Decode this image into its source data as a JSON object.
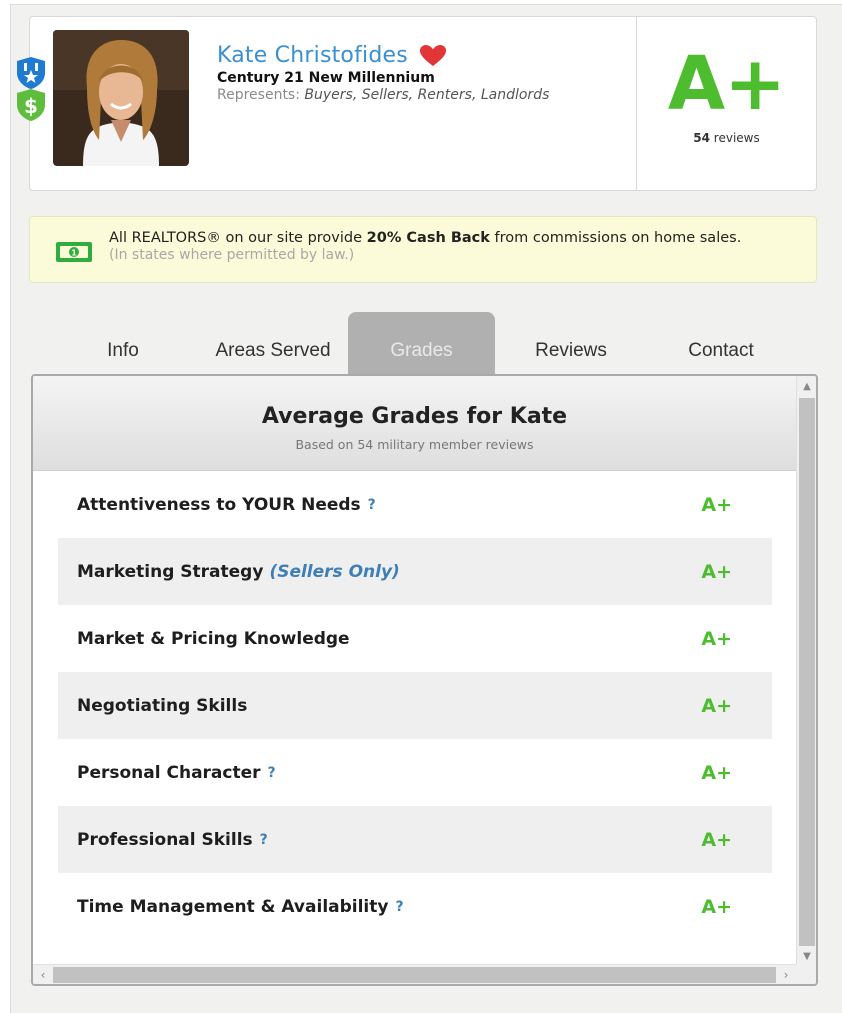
{
  "agent": {
    "name": "Kate Christofides",
    "brokerage": "Century 21 New Millennium",
    "represents_label": "Represents:",
    "represents_values": "Buyers, Sellers, Renters, Landlords",
    "overall_grade": "A+",
    "review_count": "54",
    "review_suffix": "reviews"
  },
  "banner": {
    "text_pre": "All REALTORS® on our site provide ",
    "text_bold": "20% Cash Back",
    "text_post": " from commissions on home sales.",
    "note": "(In states where permitted by law.)"
  },
  "tabs": [
    {
      "label": "Info",
      "active": false
    },
    {
      "label": "Areas Served",
      "active": false
    },
    {
      "label": "Grades",
      "active": true
    },
    {
      "label": "Reviews",
      "active": false
    },
    {
      "label": "Contact",
      "active": false
    }
  ],
  "panel": {
    "title": "Average Grades for Kate",
    "subtitle": "Based on 54 military member reviews"
  },
  "grades": [
    {
      "label": "Attentiveness to YOUR Needs",
      "qualifier": "",
      "help": "?",
      "grade": "A+"
    },
    {
      "label": "Marketing Strategy",
      "qualifier": "(Sellers Only)",
      "help": "",
      "grade": "A+"
    },
    {
      "label": "Market & Pricing Knowledge",
      "qualifier": "",
      "help": "",
      "grade": "A+"
    },
    {
      "label": "Negotiating Skills",
      "qualifier": "",
      "help": "",
      "grade": "A+"
    },
    {
      "label": "Personal Character",
      "qualifier": "",
      "help": "?",
      "grade": "A+"
    },
    {
      "label": "Professional Skills",
      "qualifier": "",
      "help": "?",
      "grade": "A+"
    },
    {
      "label": "Time Management & Availability",
      "qualifier": "",
      "help": "?",
      "grade": "A+"
    }
  ],
  "colors": {
    "name_blue": "#3a8fd0",
    "grade_green": "#4dbd2f",
    "link_blue": "#3f7fb6",
    "heart_red": "#e23636",
    "badge_blue": "#1f7bd1",
    "badge_green": "#5ebd3c",
    "banner_bg": "#fbfbd9",
    "active_tab": "#b0b0b0"
  },
  "icons": {
    "badge_top": "military-shield-icon",
    "badge_bottom": "dollar-shield-icon",
    "heart": "heart-icon",
    "money": "money-bill-icon",
    "help": "help-question-icon"
  }
}
